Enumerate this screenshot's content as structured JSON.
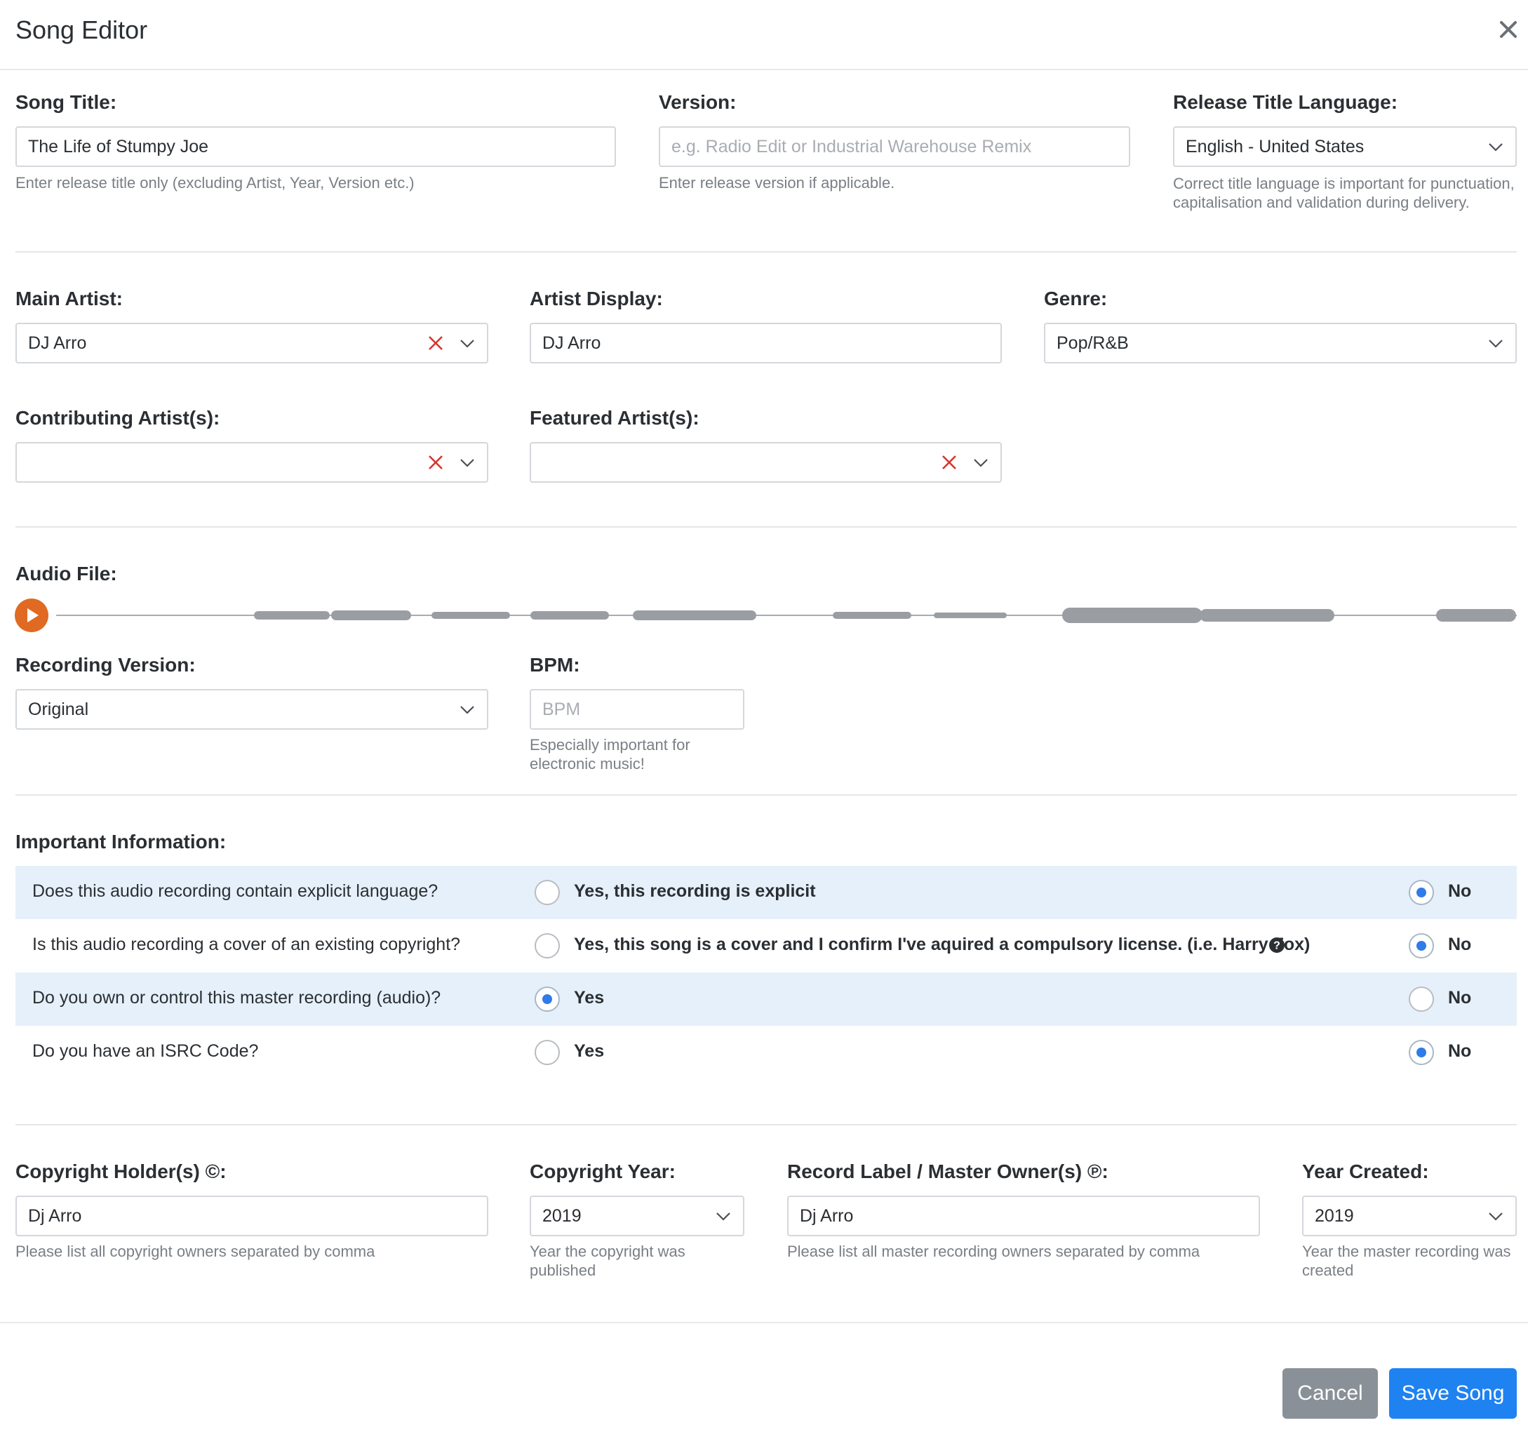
{
  "window": {
    "title": "Song Editor",
    "close_icon": "close-icon"
  },
  "song_title": {
    "label": "Song Title:",
    "value": "The Life of Stumpy Joe",
    "help": "Enter release title only (excluding Artist, Year, Version etc.)"
  },
  "version": {
    "label": "Version:",
    "placeholder": "e.g. Radio Edit or Industrial Warehouse Remix",
    "help": "Enter release version if applicable."
  },
  "release_language": {
    "label": "Release Title Language:",
    "value": "English - United States",
    "help": "Correct title language is important for punctuation, capitalisation and validation during delivery."
  },
  "main_artist": {
    "label": "Main Artist:",
    "value": "DJ Arro"
  },
  "artist_display": {
    "label": "Artist Display:",
    "value": "DJ Arro"
  },
  "genre": {
    "label": "Genre:",
    "value": "Pop/R&B"
  },
  "contributing_artists": {
    "label": "Contributing Artist(s):",
    "value": ""
  },
  "featured_artists": {
    "label": "Featured Artist(s):",
    "value": ""
  },
  "audio_file": {
    "label": "Audio File:",
    "play_icon": "play-icon"
  },
  "recording_version": {
    "label": "Recording Version:",
    "value": "Original"
  },
  "bpm": {
    "label": "BPM:",
    "placeholder": "BPM",
    "help": "Especially important for electronic music!"
  },
  "important": {
    "label": "Important Information:",
    "questions": [
      {
        "text": "Does this audio recording contain explicit language?",
        "yes_label": "Yes, this recording is explicit",
        "no_label": "No",
        "selected": "no"
      },
      {
        "text": "Is this audio recording a cover of an existing copyright?",
        "yes_label": "Yes, this song is a cover and I confirm I've aquired a compulsory license. (i.e. Harry Fox)",
        "no_label": "No",
        "selected": "no"
      },
      {
        "text": "Do you own or control this master recording (audio)?",
        "yes_label": "Yes",
        "no_label": "No",
        "selected": "yes"
      },
      {
        "text": "Do you have an ISRC Code?",
        "yes_label": "Yes",
        "no_label": "No",
        "selected": "no"
      }
    ]
  },
  "copyright_holder": {
    "label": "Copyright Holder(s) ©:",
    "value": "Dj Arro",
    "help": "Please list all copyright owners separated by comma"
  },
  "copyright_year": {
    "label": "Copyright Year:",
    "value": "2019",
    "help": "Year the copyright was published"
  },
  "record_label": {
    "label": "Record Label / Master Owner(s) ℗:",
    "value": "Dj Arro",
    "help": "Please list all master recording owners separated by comma"
  },
  "year_created": {
    "label": "Year Created:",
    "value": "2019",
    "help": "Year the master recording was created"
  },
  "footer": {
    "cancel_label": "Cancel",
    "save_label": "Save Song"
  },
  "colors": {
    "accent": "#1f82f1",
    "radio_selected": "#2f7bea",
    "row_highlight": "#e6f0fa",
    "clear_x": "#d9342b",
    "play_button": "#e06a22",
    "cancel_button": "#8a9097"
  }
}
